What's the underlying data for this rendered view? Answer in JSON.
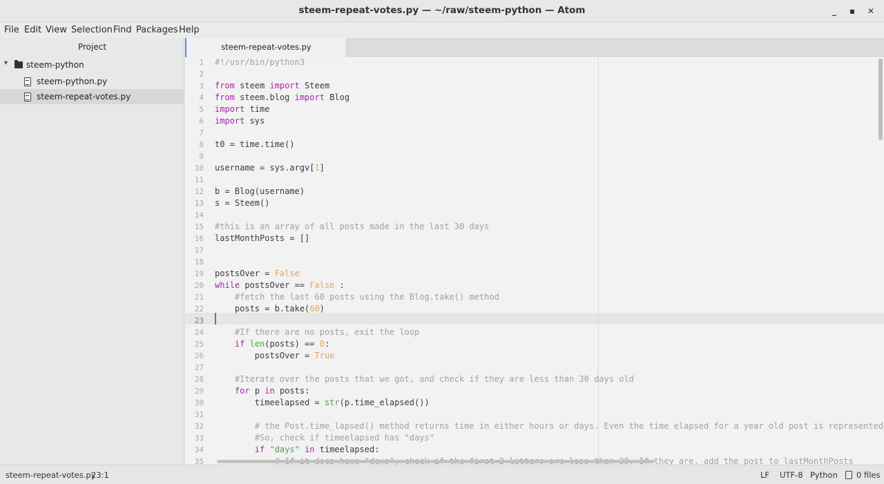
{
  "window": {
    "title": "steem-repeat-votes.py — ~/raw/steem-python — Atom",
    "minimize_glyph": "_",
    "maximize_glyph": "▪",
    "close_glyph": "✕"
  },
  "menu": [
    "File",
    "Edit",
    "View",
    "Selection",
    "Find",
    "Packages",
    "Help"
  ],
  "sidebar": {
    "header": "Project",
    "root_folder": "steem-python",
    "chevron_glyph": "▾",
    "files": [
      {
        "name": "steem-python.py",
        "selected": false
      },
      {
        "name": "steem-repeat-votes.py",
        "selected": true
      }
    ]
  },
  "tabs": [
    {
      "label": "steem-repeat-votes.py",
      "active": true
    }
  ],
  "editor": {
    "cursor_line": 23,
    "lines": [
      "#!/usr/bin/python3",
      "",
      "from steem import Steem",
      "from steem.blog import Blog",
      "import time",
      "import sys",
      "",
      "t0 = time.time()",
      "",
      "username = sys.argv[1]",
      "",
      "b = Blog(username)",
      "s = Steem()",
      "",
      "#this is an array of all posts made in the last 30 days",
      "lastMonthPosts = []",
      "",
      "",
      "postsOver = False",
      "while postsOver == False :",
      "    #fetch the last 60 posts using the Blog.take() method",
      "    posts = b.take(60)",
      "",
      "    #If there are no posts, exit the loop",
      "    if len(posts) == 0:",
      "        postsOver = True",
      "",
      "    #Iterate over the posts that we got, and check if they are less than 30 days old",
      "    for p in posts:",
      "        timeelapsed = str(p.time_elapsed())",
      "",
      "        # the Post.time_lapsed() method returns time in either hours or days. Even the time elapsed for a year old post is represented in",
      "        #So, check if timeelapsed has \"days\"",
      "        if \"days\" in timeelapsed:",
      "            # If it does have \"days\", check if the first 2 letters are less than 30. If they are, add the post to lastMonthPosts"
    ]
  },
  "statusbar": {
    "file": "steem-repeat-votes.py",
    "cursor_pos": "23:1",
    "line_ending": "LF",
    "encoding": "UTF-8",
    "grammar": "Python",
    "git_files": "0 files"
  }
}
